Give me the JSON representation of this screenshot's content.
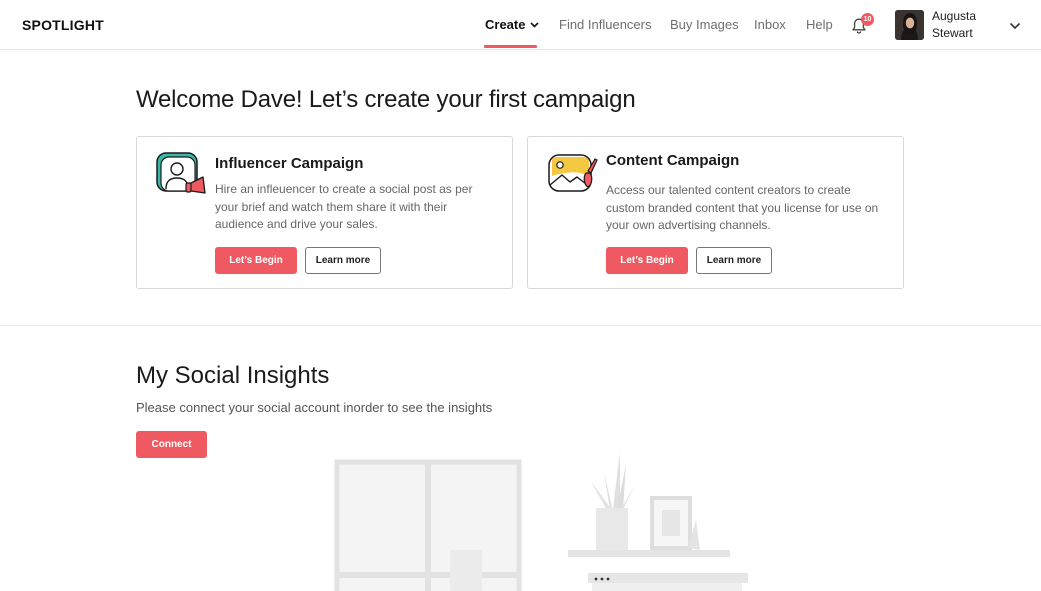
{
  "header": {
    "logo": "SPOTLIGHT",
    "nav": {
      "create": "Create",
      "find_influencers": "Find Influencers",
      "buy_images": "Buy Images",
      "inbox": "Inbox",
      "help": "Help"
    },
    "notification_count": "10",
    "user": {
      "name": "Augusta Stewart"
    }
  },
  "welcome": {
    "title": "Welcome Dave! Let’s create your first campaign",
    "cards": [
      {
        "title": "Influencer Campaign",
        "description": "Hire an infleuencer to create a social post as per your brief and watch them share it with their audience and drive your sales.",
        "primary_label": "Let’s Begin",
        "secondary_label": "Learn more",
        "icon": "megaphone-person-icon"
      },
      {
        "title": "Content Campaign",
        "description": "Access our talented content creators to create custom branded content that you license for use on your own advertising channels.",
        "primary_label": "Let’s Begin",
        "secondary_label": "Learn more",
        "icon": "image-brush-icon"
      }
    ]
  },
  "insights": {
    "title": "My Social Insights",
    "subtitle": "Please connect your social account inorder to see the insights",
    "connect_label": "Connect"
  },
  "colors": {
    "accent": "#ef5a62",
    "teal": "#3bb6a8",
    "yellow": "#f5c842"
  }
}
